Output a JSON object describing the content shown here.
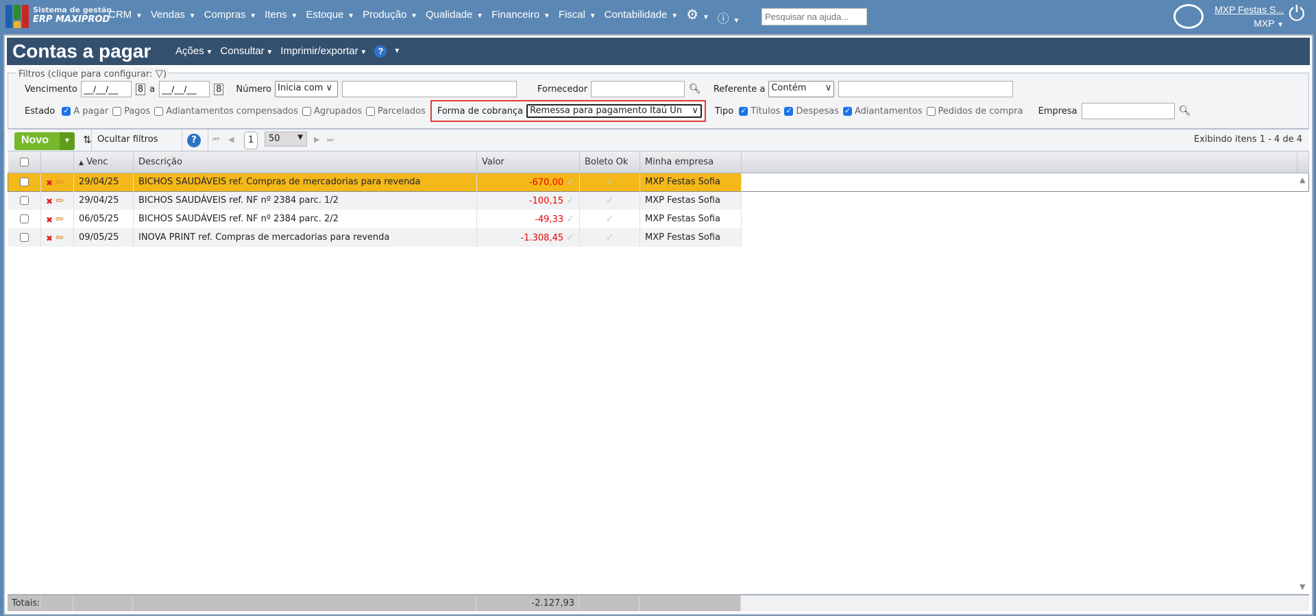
{
  "topbar": {
    "logo_line1": "Sistema de gestão",
    "logo_line2": "ERP MAXIPROD",
    "menu": [
      "CRM",
      "Vendas",
      "Compras",
      "Itens",
      "Estoque",
      "Produção",
      "Qualidade",
      "Financeiro",
      "Fiscal",
      "Contabilidade"
    ],
    "help_placeholder": "Pesquisar na ajuda...",
    "user_name": "MXP Festas S...",
    "company_short": "MXP"
  },
  "page": {
    "title": "Contas a pagar",
    "menu": [
      "Ações",
      "Consultar",
      "Imprimir/exportar"
    ],
    "help": "?"
  },
  "filters": {
    "legend": "Filtros (clique para configurar:",
    "legend_close": ")",
    "vencimento_label": "Vencimento",
    "date_from": "__/__/__",
    "date_sep": "a",
    "date_to": "__/__/__",
    "numero_label": "Número",
    "numero_mode": "Inicia com",
    "numero_value": "",
    "fornecedor_label": "Fornecedor",
    "fornecedor_value": "",
    "referente_label": "Referente a",
    "referente_mode": "Contém",
    "referente_value": "",
    "estado_label": "Estado",
    "estado": [
      {
        "label": "A pagar",
        "checked": true
      },
      {
        "label": "Pagos",
        "checked": false
      },
      {
        "label": "Adiantamentos compensados",
        "checked": false
      },
      {
        "label": "Agrupados",
        "checked": false
      },
      {
        "label": "Parcelados",
        "checked": false
      }
    ],
    "forma_label": "Forma de cobrança",
    "forma_value": "Remessa para pagamento Itaú Un",
    "tipo_label": "Tipo",
    "tipo": [
      {
        "label": "Títulos",
        "checked": true
      },
      {
        "label": "Despesas",
        "checked": true
      },
      {
        "label": "Adiantamentos",
        "checked": true
      },
      {
        "label": "Pedidos de compra",
        "checked": false
      }
    ],
    "empresa_label": "Empresa",
    "empresa_value": ""
  },
  "toolbar": {
    "new_label": "Novo",
    "hide_filters": "Ocultar filtros",
    "page": "1",
    "page_size": "50",
    "status": "Exibindo itens 1 - 4 de 4"
  },
  "table": {
    "columns": [
      "Venc",
      "Descrição",
      "Valor",
      "Boleto Ok",
      "Minha empresa"
    ],
    "rows": [
      {
        "venc": "29/04/25",
        "desc": "BICHOS SAUDÁVEIS ref. Compras de mercadorias para revenda",
        "valor": "-670,00",
        "empresa": "MXP Festas Sofia",
        "selected": true
      },
      {
        "venc": "29/04/25",
        "desc": "BICHOS SAUDÁVEIS ref. NF nº 2384 parc. 1/2",
        "valor": "-100,15",
        "empresa": "MXP Festas Sofia"
      },
      {
        "venc": "06/05/25",
        "desc": "BICHOS SAUDÁVEIS ref. NF nº 2384 parc. 2/2",
        "valor": "-49,33",
        "empresa": "MXP Festas Sofia"
      },
      {
        "venc": "09/05/25",
        "desc": "INOVA PRINT ref. Compras de mercadorias para revenda",
        "valor": "-1.308,45",
        "empresa": "MXP Festas Sofia"
      }
    ],
    "totals_label": "Totais:",
    "total_valor": "-2.127,93"
  },
  "colors": {
    "topbar": "#5b87b4",
    "titlebar": "#34506f",
    "selected_row": "#f5b81a",
    "negative": "#e00000",
    "new_button": "#76b82a",
    "highlight_box": "#e53935"
  }
}
